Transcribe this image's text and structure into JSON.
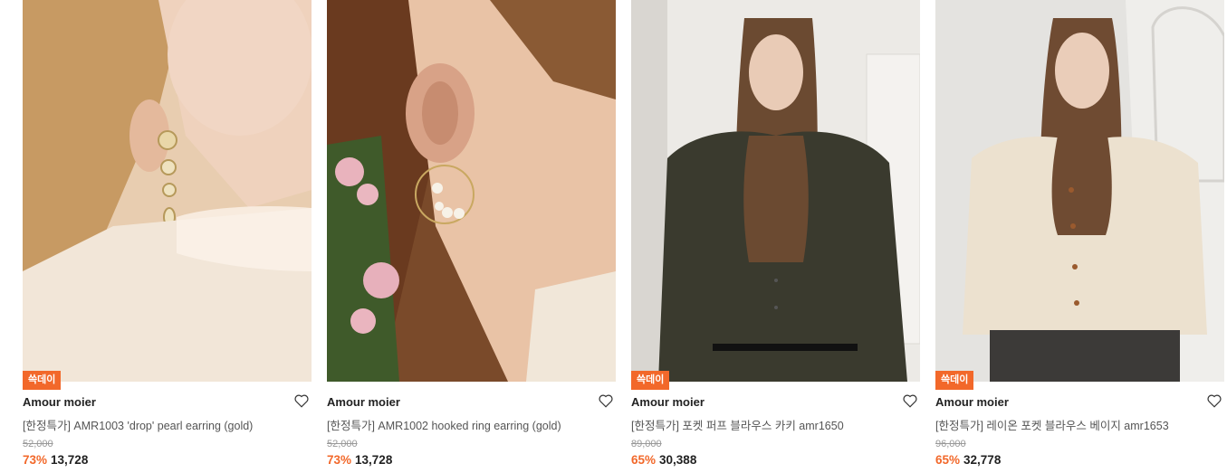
{
  "colors": {
    "accent": "#f2682a",
    "badge_text": "#ffffff"
  },
  "products": [
    {
      "badge": "쓱데이",
      "brand": "Amour moier",
      "title": "[한정특가] AMR1003 'drop' pearl earring (gold)",
      "original_price": "52,000",
      "discount": "73%",
      "price": "13,728",
      "image_subject": "woman wearing gold pearl drop earring, lace blouse"
    },
    {
      "badge": "",
      "brand": "Amour moier",
      "title": "[한정특가] AMR1002 hooked ring earring (gold)",
      "original_price": "52,000",
      "discount": "73%",
      "price": "13,728",
      "image_subject": "close-up ear with pearl hoop earring and pink flowers"
    },
    {
      "badge": "쓱데이",
      "brand": "Amour moier",
      "title": "[한정특가] 포켓 퍼프 블라우스 카키 amr1650",
      "original_price": "89,000",
      "discount": "65%",
      "price": "30,388",
      "image_subject": "woman in khaki puff blouse"
    },
    {
      "badge": "쓱데이",
      "brand": "Amour moier",
      "title": "[한정특가] 레이온 포켓 블라우스 베이지 amr1653",
      "original_price": "96,000",
      "discount": "65%",
      "price": "32,778",
      "image_subject": "woman in beige rayon pocket blouse"
    }
  ]
}
